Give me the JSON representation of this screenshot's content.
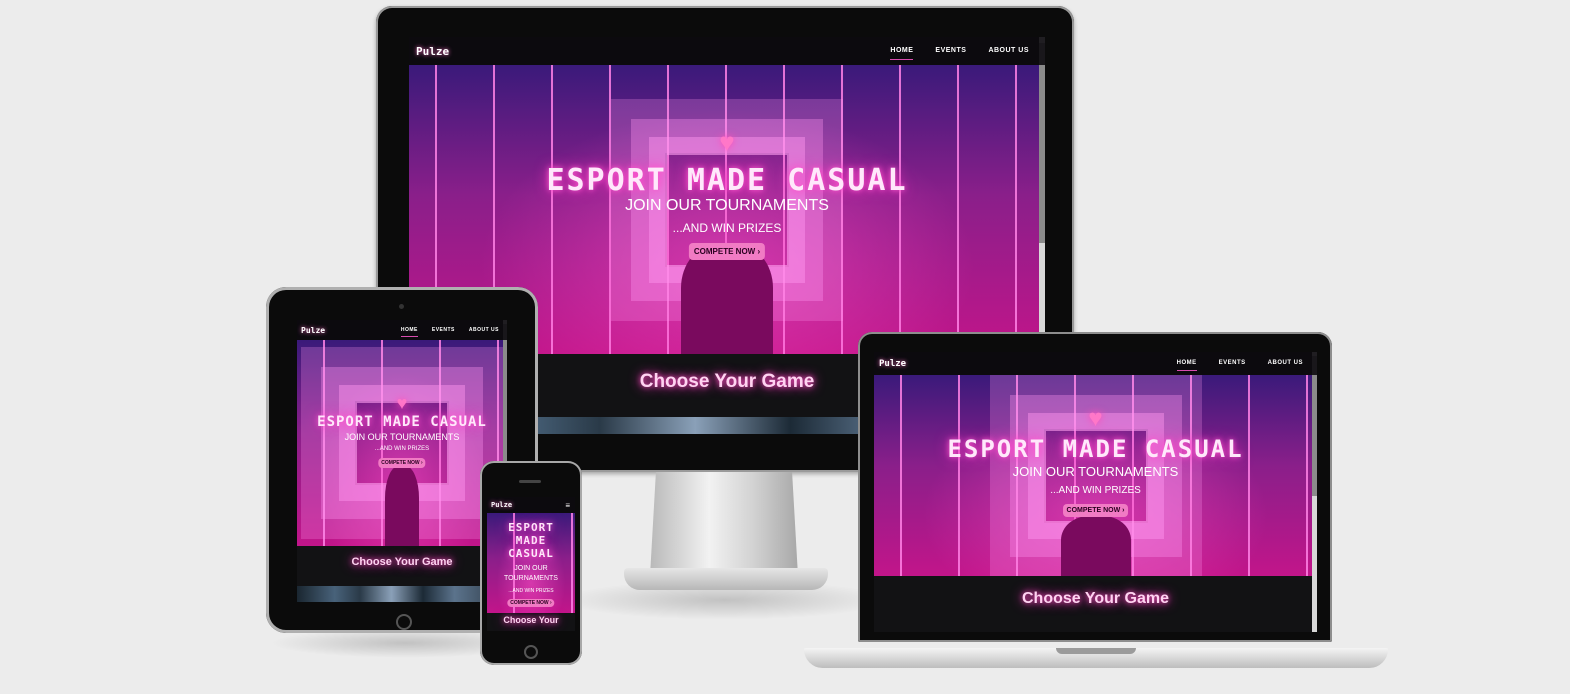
{
  "site": {
    "logo": "Pulze",
    "nav": [
      "HOME",
      "EVENTS",
      "ABOUT US"
    ],
    "hero_title": "ESPORT MADE CASUAL",
    "hero_title_mobile": [
      "ESPORT",
      "MADE",
      "CASUAL"
    ],
    "hero_sub1": "JOIN OUR TOURNAMENTS",
    "hero_sub1_mobile": [
      "JOIN OUR",
      "TOURNAMENTS"
    ],
    "hero_sub2": "...AND WIN PRIZES",
    "cta": "COMPETE NOW ›",
    "games_title": "Choose Your Game",
    "games_title_mobile": "Choose Your"
  },
  "icons": {
    "heart": "heart-icon",
    "menu": "hamburger-icon"
  },
  "colors": {
    "accent": "#f17bc4",
    "neon": "#ff4fc0",
    "background": "#ececec"
  }
}
